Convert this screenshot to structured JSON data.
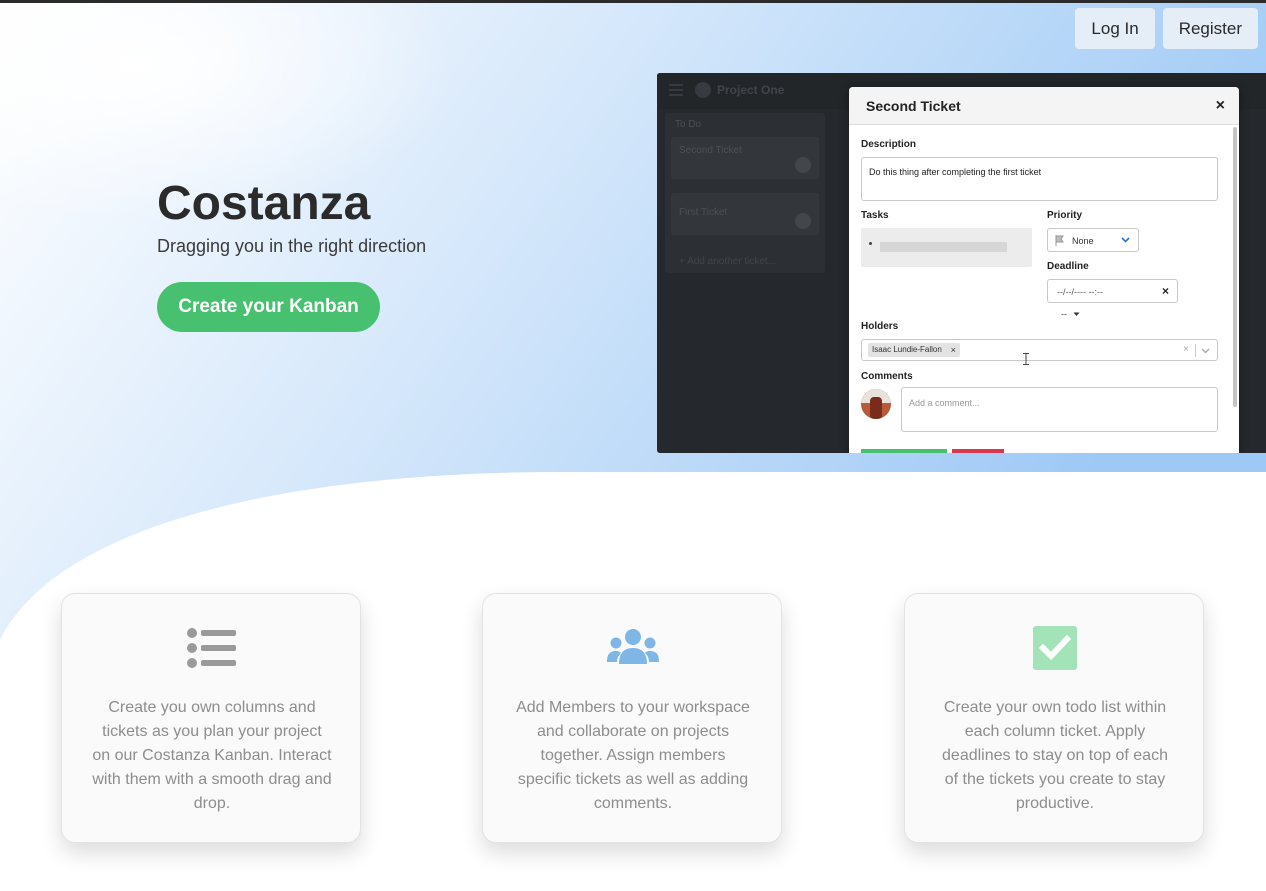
{
  "nav": {
    "login_label": "Log In",
    "register_label": "Register"
  },
  "hero": {
    "title": "Costanza",
    "subtitle": "Dragging you in the right direction",
    "cta_label": "Create your Kanban"
  },
  "screenshot": {
    "project_name": "Project One",
    "column_name": "To Do",
    "cards": [
      "Second Ticket",
      "First Ticket"
    ],
    "add_ticket_label": "+ Add another ticket...",
    "modal": {
      "title": "Second Ticket",
      "close_glyph": "×",
      "description_label": "Description",
      "description_value": "Do this thing after completing the first ticket",
      "tasks_label": "Tasks",
      "priority_label": "Priority",
      "priority_value": "None",
      "deadline_label": "Deadline",
      "deadline_placeholder": "--/--/---- --:--",
      "time_select": "--",
      "holders_label": "Holders",
      "holder_chip": "Isaac Lundie-Fallon",
      "comments_label": "Comments",
      "comment_placeholder": "Add a comment..."
    }
  },
  "features": [
    {
      "icon": "list-icon",
      "text": "Create you own columns and tickets as you plan your project on our Costanza Kanban. Interact with them with a smooth drag and drop."
    },
    {
      "icon": "users-icon",
      "text": "Add Members to your workspace and collaborate on projects together. Assign members specific tickets as well as adding comments."
    },
    {
      "icon": "checkbox-icon",
      "text": "Create your own todo list within each column ticket. Apply deadlines to stay on top of each of the tickets you create to stay productive."
    }
  ],
  "colors": {
    "accent_green": "#47c16f",
    "accent_blue": "#7eb6e6",
    "check_green": "#a2e3b7"
  }
}
